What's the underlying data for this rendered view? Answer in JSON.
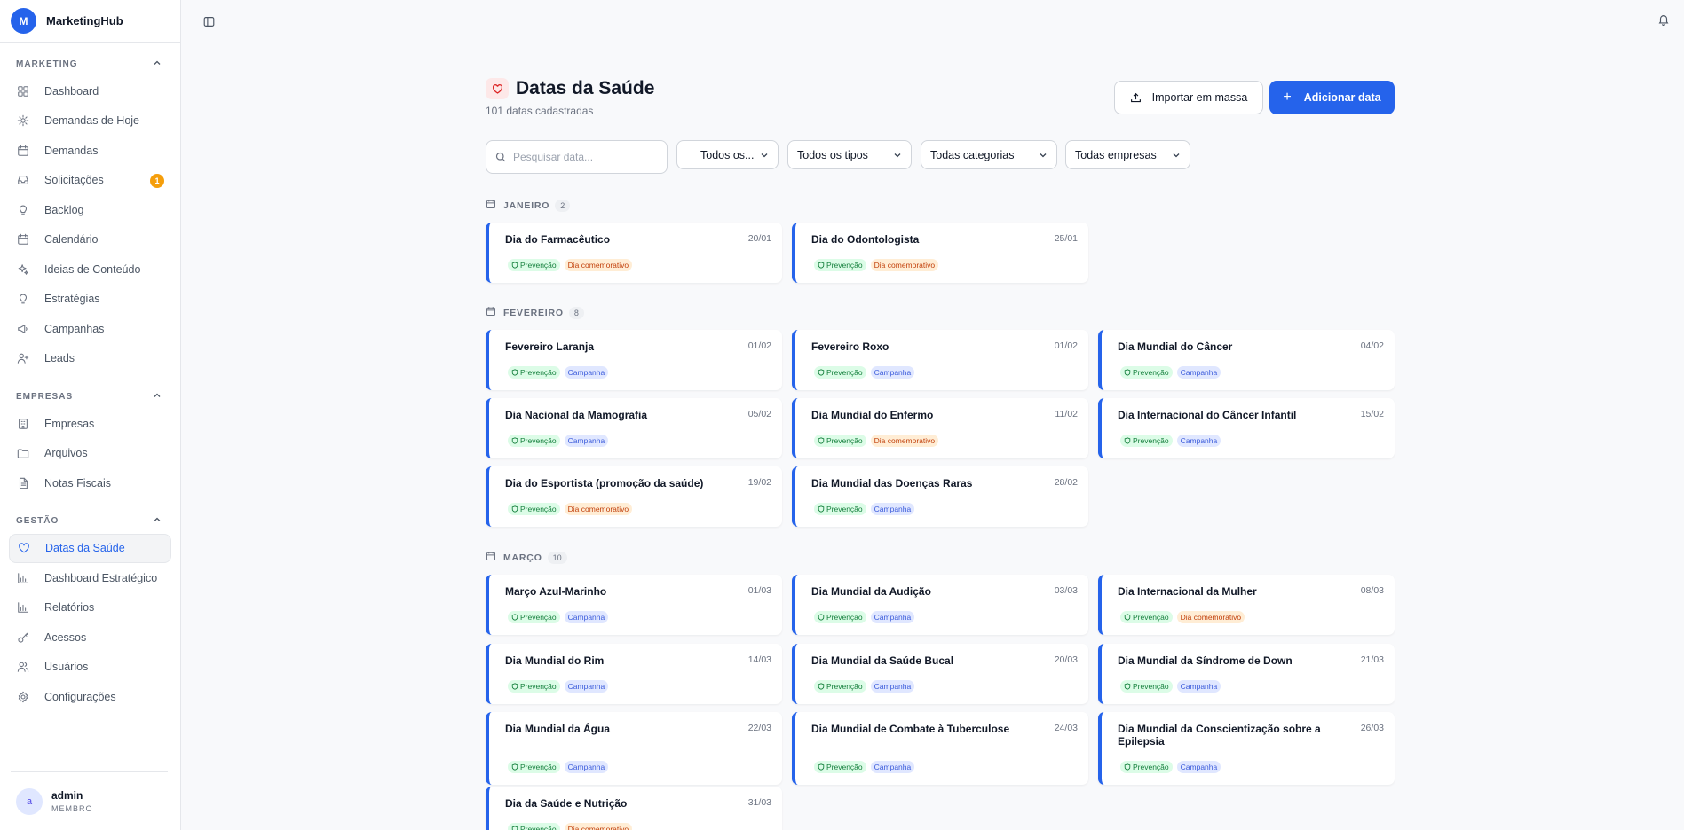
{
  "brand": {
    "logo_letter": "M",
    "name": "MarketingHub"
  },
  "sidebar": {
    "sections": [
      {
        "title": "MARKETING",
        "items": [
          {
            "label": "Dashboard",
            "icon": "dashboard-icon"
          },
          {
            "label": "Demandas de Hoje",
            "icon": "sun-icon"
          },
          {
            "label": "Demandas",
            "icon": "calendar-check-icon"
          },
          {
            "label": "Solicitações",
            "icon": "inbox-icon",
            "badge": "1"
          },
          {
            "label": "Backlog",
            "icon": "lightbulb-icon"
          },
          {
            "label": "Calendário",
            "icon": "calendar-icon"
          },
          {
            "label": "Ideias de Conteúdo",
            "icon": "sparkles-icon"
          },
          {
            "label": "Estratégias",
            "icon": "lightbulb-icon"
          },
          {
            "label": "Campanhas",
            "icon": "megaphone-icon"
          },
          {
            "label": "Leads",
            "icon": "user-plus-icon"
          }
        ]
      },
      {
        "title": "EMPRESAS",
        "items": [
          {
            "label": "Empresas",
            "icon": "building-icon"
          },
          {
            "label": "Arquivos",
            "icon": "folder-icon"
          },
          {
            "label": "Notas Fiscais",
            "icon": "file-text-icon"
          }
        ]
      },
      {
        "title": "GESTÃO",
        "items": [
          {
            "label": "Datas da Saúde",
            "icon": "heart-icon",
            "active": true
          },
          {
            "label": "Dashboard Estratégico",
            "icon": "bar-chart-icon"
          },
          {
            "label": "Relatórios",
            "icon": "bar-chart-icon"
          },
          {
            "label": "Acessos",
            "icon": "key-icon"
          },
          {
            "label": "Usuários",
            "icon": "users-icon"
          },
          {
            "label": "Configurações",
            "icon": "gear-icon"
          }
        ]
      }
    ]
  },
  "user": {
    "avatar": "a",
    "name": "admin",
    "role": "MEMBRO"
  },
  "header": {
    "title": "Datas da Saúde",
    "subtitle": "101 datas cadastradas",
    "import_label": "Importar em massa",
    "add_label": "Adicionar data"
  },
  "filters": {
    "search_placeholder": "Pesquisar data...",
    "status": "Todos os...",
    "types": "Todos os tipos",
    "categories": "Todas categorias",
    "companies": "Todas empresas"
  },
  "colors": {
    "accent": "#2563eb",
    "prevencao": "#15803d",
    "campanha": "#3b5bdb",
    "dia_comemorativo": "#c2410c"
  },
  "tags": {
    "prevencao": "Prevenção",
    "campanha": "Campanha",
    "dia": "Dia comemorativo"
  },
  "months": [
    {
      "label": "JANEIRO",
      "count": "2",
      "items": [
        {
          "title": "Dia do Farmacêutico",
          "date": "20/01",
          "tag": "dia"
        },
        {
          "title": "Dia do Odontologista",
          "date": "25/01",
          "tag": "dia"
        }
      ]
    },
    {
      "label": "FEVEREIRO",
      "count": "8",
      "items": [
        {
          "title": "Fevereiro Laranja",
          "date": "01/02",
          "tag": "campanha"
        },
        {
          "title": "Fevereiro Roxo",
          "date": "01/02",
          "tag": "campanha"
        },
        {
          "title": "Dia Mundial do Câncer",
          "date": "04/02",
          "tag": "campanha"
        },
        {
          "title": "Dia Nacional da Mamografia",
          "date": "05/02",
          "tag": "campanha"
        },
        {
          "title": "Dia Mundial do Enfermo",
          "date": "11/02",
          "tag": "dia"
        },
        {
          "title": "Dia Internacional do Câncer Infantil",
          "date": "15/02",
          "tag": "campanha"
        },
        {
          "title": "Dia do Esportista (promoção da saúde)",
          "date": "19/02",
          "tag": "dia"
        },
        {
          "title": "Dia Mundial das Doenças Raras",
          "date": "28/02",
          "tag": "campanha"
        }
      ]
    },
    {
      "label": "MARÇO",
      "count": "10",
      "items": [
        {
          "title": "Março Azul-Marinho",
          "date": "01/03",
          "tag": "campanha"
        },
        {
          "title": "Dia Mundial da Audição",
          "date": "03/03",
          "tag": "campanha"
        },
        {
          "title": "Dia Internacional da Mulher",
          "date": "08/03",
          "tag": "dia"
        },
        {
          "title": "Dia Mundial do Rim",
          "date": "14/03",
          "tag": "campanha"
        },
        {
          "title": "Dia Mundial da Saúde Bucal",
          "date": "20/03",
          "tag": "campanha"
        },
        {
          "title": "Dia Mundial da Síndrome de Down",
          "date": "21/03",
          "tag": "campanha"
        },
        {
          "title": "Dia Mundial da Água",
          "date": "22/03",
          "tag": "campanha"
        },
        {
          "title": "Dia Mundial de Combate à Tuberculose",
          "date": "24/03",
          "tag": "campanha"
        },
        {
          "title": "Dia Mundial da Conscientização sobre a Epilepsia",
          "date": "26/03",
          "tag": "campanha"
        },
        {
          "title": "Dia da Saúde e Nutrição",
          "date": "31/03",
          "tag": "dia"
        }
      ]
    }
  ]
}
